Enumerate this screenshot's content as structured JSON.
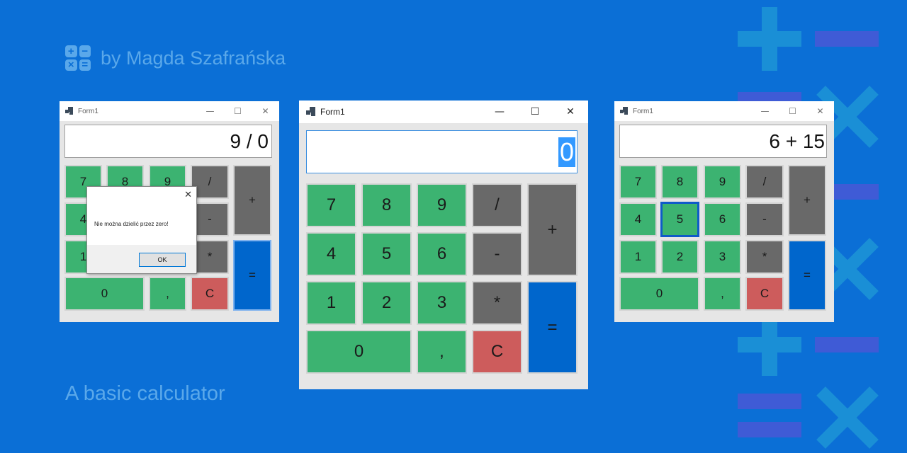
{
  "brand": {
    "author": "by Magda Szafrańska",
    "tagline": "A basic calculator",
    "logo_symbols": [
      "+",
      "−",
      "×",
      "="
    ]
  },
  "window_controls": {
    "minimize": "—",
    "maximize": "☐",
    "close": "✕"
  },
  "windows": [
    {
      "title": "Form1",
      "display": "9 / 0",
      "buttons": {
        "b7": "7",
        "b8": "8",
        "b9": "9",
        "div": "/",
        "plus": "+",
        "b4": "4",
        "minus": "-",
        "b1": "1",
        "mul": "*",
        "eq": "=",
        "b0": "0",
        "comma": ",",
        "clear": "C"
      },
      "dialog": {
        "message": "Nie można dzielić przez zero!",
        "ok": "OK",
        "close": "✕"
      }
    },
    {
      "title": "Form1",
      "display": "0",
      "buttons": {
        "b7": "7",
        "b8": "8",
        "b9": "9",
        "div": "/",
        "plus": "+",
        "b4": "4",
        "b5": "5",
        "b6": "6",
        "minus": "-",
        "b1": "1",
        "b2": "2",
        "b3": "3",
        "mul": "*",
        "eq": "=",
        "b0": "0",
        "comma": ",",
        "clear": "C"
      }
    },
    {
      "title": "Form1",
      "display": "6 + 15",
      "buttons": {
        "b7": "7",
        "b8": "8",
        "b9": "9",
        "div": "/",
        "plus": "+",
        "b4": "4",
        "b5": "5",
        "b6": "6",
        "minus": "-",
        "b1": "1",
        "b2": "2",
        "b3": "3",
        "mul": "*",
        "eq": "=",
        "b0": "0",
        "comma": ",",
        "clear": "C"
      }
    }
  ],
  "colors": {
    "background": "#0b6fd6",
    "digit_button": "#3cb371",
    "operator_button": "#696969",
    "clear_button": "#cd5c5c",
    "equals_button": "#0066cc"
  }
}
